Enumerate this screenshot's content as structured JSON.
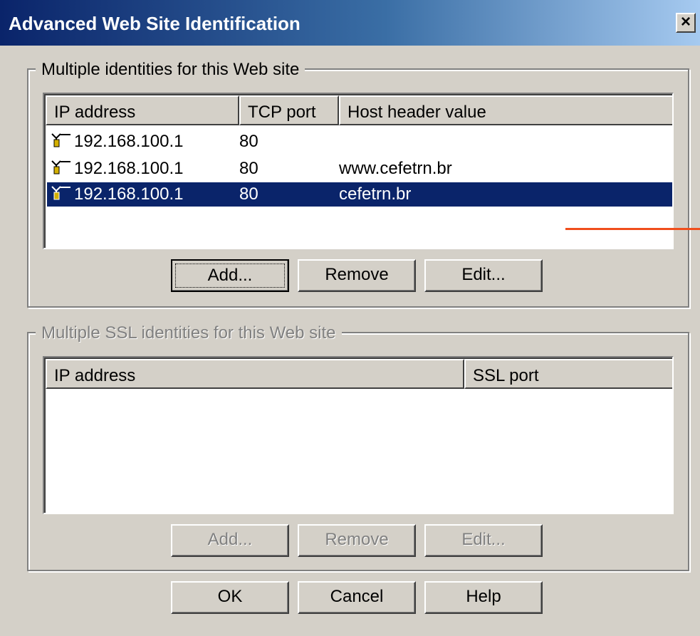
{
  "window": {
    "title": "Advanced Web Site Identification",
    "close_label": "×"
  },
  "identities": {
    "legend": "Multiple identities for this Web site",
    "columns": [
      "IP address",
      "TCP port",
      "Host header value"
    ],
    "rows": [
      {
        "ip": "192.168.100.1",
        "port": "80",
        "host": ""
      },
      {
        "ip": "192.168.100.1",
        "port": "80",
        "host": "www.cefetrn.br"
      },
      {
        "ip": "192.168.100.1",
        "port": "80",
        "host": "cefetrn.br",
        "selected": true
      }
    ],
    "buttons": {
      "add": "Add...",
      "remove": "Remove",
      "edit": "Edit..."
    }
  },
  "ssl": {
    "legend": "Multiple SSL identities for this Web site",
    "columns": [
      "IP address",
      "SSL port"
    ],
    "rows": [],
    "buttons": {
      "add": "Add...",
      "remove": "Remove",
      "edit": "Edit..."
    }
  },
  "footer": {
    "ok": "OK",
    "cancel": "Cancel",
    "help": "Help"
  },
  "colors": {
    "selection": "#0a246a",
    "dialog_bg": "#d4d0c8",
    "annotation": "#f04e1c"
  },
  "icons": {
    "row_icon": "network-connector-icon"
  }
}
